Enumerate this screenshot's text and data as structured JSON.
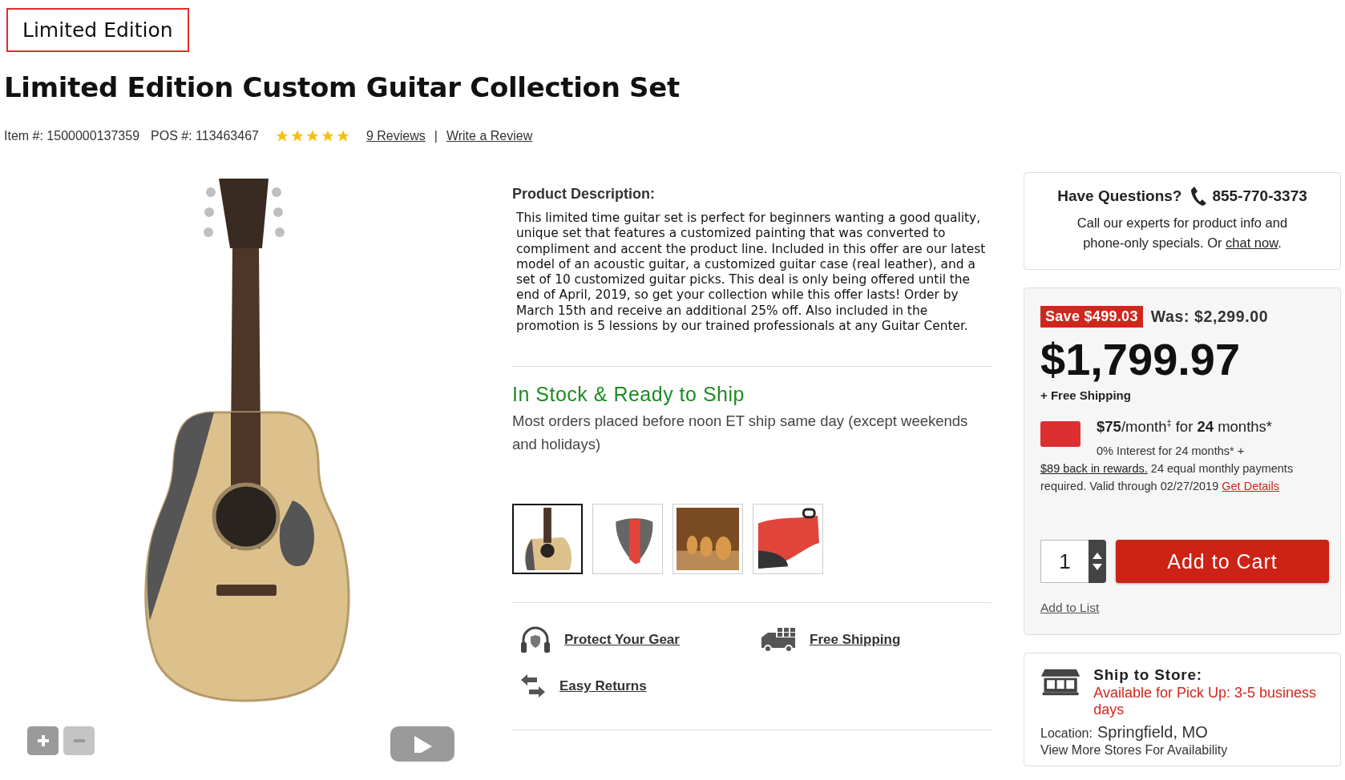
{
  "badge": "Limited Edition",
  "title": "Limited Edition Custom Guitar Collection Set",
  "meta": {
    "item": "Item #: 1500000137359",
    "pos": "POS #: 113463467",
    "stars": 5,
    "reviews": "9 Reviews",
    "separator": "|",
    "write_review": "Write a Review"
  },
  "description": {
    "heading": "Product Description:",
    "text": "This limited time guitar set is perfect for beginners wanting a good quality, unique set that features a customized painting that was converted to compliment and accent the product line. Included in this offer are our latest model of an acoustic guitar, a customized guitar case (real leather), and a set of 10 customized guitar picks. This deal is only being offered until the end of April, 2019, so get your collection while this offer lasts! Order by March 15th and receive an additional 25% off. Also included in the promotion is 5 lessions by our trained professionals at any Guitar Center."
  },
  "stock": {
    "heading": "In Stock & Ready to Ship",
    "note": "Most orders placed before noon ET ship same day (except weekends and holidays)"
  },
  "thumbnails": [
    {
      "kind": "guitar",
      "selected": true
    },
    {
      "kind": "pick",
      "selected": false
    },
    {
      "kind": "store",
      "selected": false
    },
    {
      "kind": "case",
      "selected": false
    }
  ],
  "perks": [
    {
      "kind": "headphones",
      "label": "Protect Your Gear"
    },
    {
      "kind": "truck",
      "label": "Free Shipping"
    },
    {
      "kind": "returns",
      "label": "Easy Returns"
    }
  ],
  "questions": {
    "heading": "Have Questions?",
    "phone": "855-770-3373",
    "text": "Call our experts for product info and phone-only specials. Or ",
    "link": "chat now",
    "end": "."
  },
  "price": {
    "save": "Save $499.03",
    "was": "Was: $2,299.00",
    "price": "$1,799.97",
    "shipping": "+ Free Shipping",
    "monthly": "**$75**/month$^{‡}$ for **24** months*",
    "financing": "0% Interest for 24 months* + ",
    "rewards_link": "$89 back in rewards.",
    "terms": " 24 equal monthly payments required. Valid through 02/27/2019 ",
    "details_link": "Get Details",
    "quantity": "1",
    "add_to_cart": "Add to Cart",
    "add_to_list": "Add to List"
  },
  "store": {
    "heading": "Ship to Store:",
    "availability": "Available for Pick Up: 3-5 business days",
    "location_label": "Location:",
    "location": "Springfield, MO",
    "more": "View More Stores For Availability"
  }
}
